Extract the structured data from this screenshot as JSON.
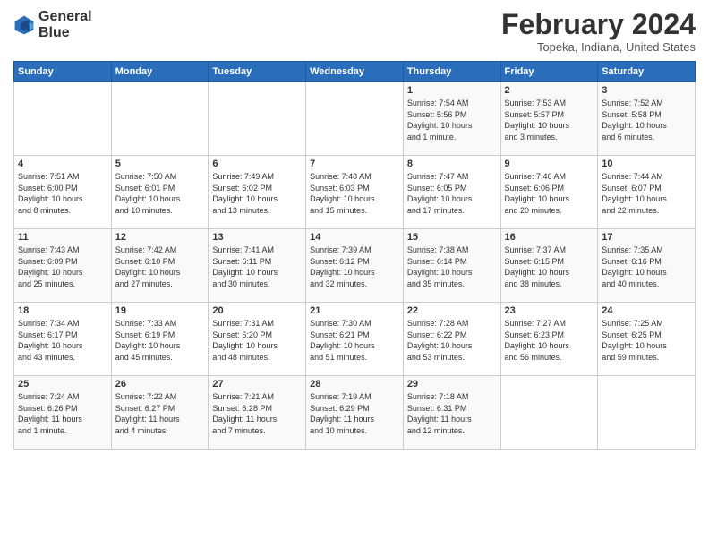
{
  "header": {
    "logo_line1": "General",
    "logo_line2": "Blue",
    "month_title": "February 2024",
    "location": "Topeka, Indiana, United States"
  },
  "days_of_week": [
    "Sunday",
    "Monday",
    "Tuesday",
    "Wednesday",
    "Thursday",
    "Friday",
    "Saturday"
  ],
  "weeks": [
    [
      {
        "day": "",
        "info": ""
      },
      {
        "day": "",
        "info": ""
      },
      {
        "day": "",
        "info": ""
      },
      {
        "day": "",
        "info": ""
      },
      {
        "day": "1",
        "info": "Sunrise: 7:54 AM\nSunset: 5:56 PM\nDaylight: 10 hours\nand 1 minute."
      },
      {
        "day": "2",
        "info": "Sunrise: 7:53 AM\nSunset: 5:57 PM\nDaylight: 10 hours\nand 3 minutes."
      },
      {
        "day": "3",
        "info": "Sunrise: 7:52 AM\nSunset: 5:58 PM\nDaylight: 10 hours\nand 6 minutes."
      }
    ],
    [
      {
        "day": "4",
        "info": "Sunrise: 7:51 AM\nSunset: 6:00 PM\nDaylight: 10 hours\nand 8 minutes."
      },
      {
        "day": "5",
        "info": "Sunrise: 7:50 AM\nSunset: 6:01 PM\nDaylight: 10 hours\nand 10 minutes."
      },
      {
        "day": "6",
        "info": "Sunrise: 7:49 AM\nSunset: 6:02 PM\nDaylight: 10 hours\nand 13 minutes."
      },
      {
        "day": "7",
        "info": "Sunrise: 7:48 AM\nSunset: 6:03 PM\nDaylight: 10 hours\nand 15 minutes."
      },
      {
        "day": "8",
        "info": "Sunrise: 7:47 AM\nSunset: 6:05 PM\nDaylight: 10 hours\nand 17 minutes."
      },
      {
        "day": "9",
        "info": "Sunrise: 7:46 AM\nSunset: 6:06 PM\nDaylight: 10 hours\nand 20 minutes."
      },
      {
        "day": "10",
        "info": "Sunrise: 7:44 AM\nSunset: 6:07 PM\nDaylight: 10 hours\nand 22 minutes."
      }
    ],
    [
      {
        "day": "11",
        "info": "Sunrise: 7:43 AM\nSunset: 6:09 PM\nDaylight: 10 hours\nand 25 minutes."
      },
      {
        "day": "12",
        "info": "Sunrise: 7:42 AM\nSunset: 6:10 PM\nDaylight: 10 hours\nand 27 minutes."
      },
      {
        "day": "13",
        "info": "Sunrise: 7:41 AM\nSunset: 6:11 PM\nDaylight: 10 hours\nand 30 minutes."
      },
      {
        "day": "14",
        "info": "Sunrise: 7:39 AM\nSunset: 6:12 PM\nDaylight: 10 hours\nand 32 minutes."
      },
      {
        "day": "15",
        "info": "Sunrise: 7:38 AM\nSunset: 6:14 PM\nDaylight: 10 hours\nand 35 minutes."
      },
      {
        "day": "16",
        "info": "Sunrise: 7:37 AM\nSunset: 6:15 PM\nDaylight: 10 hours\nand 38 minutes."
      },
      {
        "day": "17",
        "info": "Sunrise: 7:35 AM\nSunset: 6:16 PM\nDaylight: 10 hours\nand 40 minutes."
      }
    ],
    [
      {
        "day": "18",
        "info": "Sunrise: 7:34 AM\nSunset: 6:17 PM\nDaylight: 10 hours\nand 43 minutes."
      },
      {
        "day": "19",
        "info": "Sunrise: 7:33 AM\nSunset: 6:19 PM\nDaylight: 10 hours\nand 45 minutes."
      },
      {
        "day": "20",
        "info": "Sunrise: 7:31 AM\nSunset: 6:20 PM\nDaylight: 10 hours\nand 48 minutes."
      },
      {
        "day": "21",
        "info": "Sunrise: 7:30 AM\nSunset: 6:21 PM\nDaylight: 10 hours\nand 51 minutes."
      },
      {
        "day": "22",
        "info": "Sunrise: 7:28 AM\nSunset: 6:22 PM\nDaylight: 10 hours\nand 53 minutes."
      },
      {
        "day": "23",
        "info": "Sunrise: 7:27 AM\nSunset: 6:23 PM\nDaylight: 10 hours\nand 56 minutes."
      },
      {
        "day": "24",
        "info": "Sunrise: 7:25 AM\nSunset: 6:25 PM\nDaylight: 10 hours\nand 59 minutes."
      }
    ],
    [
      {
        "day": "25",
        "info": "Sunrise: 7:24 AM\nSunset: 6:26 PM\nDaylight: 11 hours\nand 1 minute."
      },
      {
        "day": "26",
        "info": "Sunrise: 7:22 AM\nSunset: 6:27 PM\nDaylight: 11 hours\nand 4 minutes."
      },
      {
        "day": "27",
        "info": "Sunrise: 7:21 AM\nSunset: 6:28 PM\nDaylight: 11 hours\nand 7 minutes."
      },
      {
        "day": "28",
        "info": "Sunrise: 7:19 AM\nSunset: 6:29 PM\nDaylight: 11 hours\nand 10 minutes."
      },
      {
        "day": "29",
        "info": "Sunrise: 7:18 AM\nSunset: 6:31 PM\nDaylight: 11 hours\nand 12 minutes."
      },
      {
        "day": "",
        "info": ""
      },
      {
        "day": "",
        "info": ""
      }
    ]
  ]
}
